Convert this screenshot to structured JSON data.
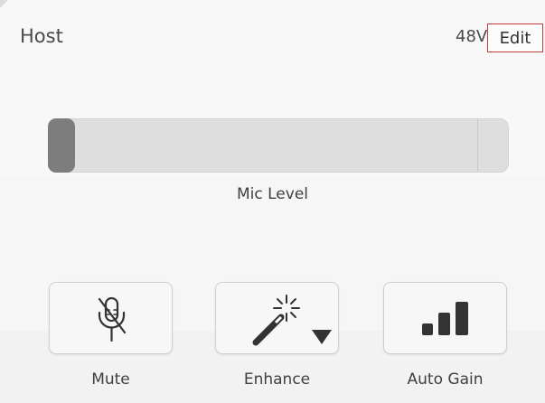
{
  "header": {
    "title": "Host",
    "phantom_power": "48V",
    "edit_label": "Edit"
  },
  "slider": {
    "label": "Mic Level",
    "level": 0.0
  },
  "controls": [
    {
      "label": "Mute",
      "icon": "mic-muted-icon"
    },
    {
      "label": "Enhance",
      "icon": "magic-wand-icon"
    },
    {
      "label": "Auto Gain",
      "icon": "signal-bars-icon"
    }
  ],
  "colors": {
    "edit_border": "#c23b3b",
    "knob": "#7d7d7d",
    "track": "#dedede"
  }
}
